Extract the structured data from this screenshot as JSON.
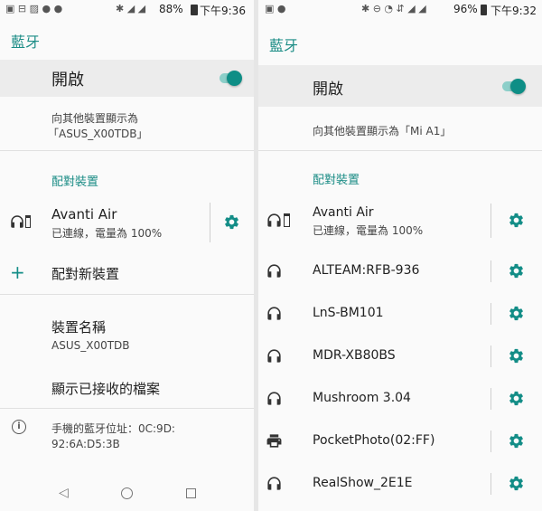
{
  "left": {
    "status": {
      "battery": "88%",
      "time": "下午9:36"
    },
    "title": "藍牙",
    "toggle_label": "開啟",
    "visibility_line1": "向其他裝置顯示為",
    "visibility_line2": "「ASUS_X00TDB」",
    "section_paired": "配對裝置",
    "device": {
      "name": "Avanti Air",
      "status": "已連線，電量為 100%"
    },
    "pair_new": "配對新裝置",
    "device_name_label": "裝置名稱",
    "device_name_value": "ASUS_X00TDB",
    "received_files": "顯示已接收的檔案",
    "address_line1": "手機的藍牙位址：0C:9D:",
    "address_line2": "92:6A:D5:3B"
  },
  "right": {
    "status": {
      "battery": "96%",
      "time": "下午9:32"
    },
    "title": "藍牙",
    "toggle_label": "開啟",
    "visibility": "向其他裝置顯示為「Mi A1」",
    "section_paired": "配對裝置",
    "devices": [
      {
        "name": "Avanti Air",
        "status": "已連線，電量為 100%",
        "icon": "headset-battery-icon"
      },
      {
        "name": "ALTEAM:RFB-936",
        "icon": "headphones-icon"
      },
      {
        "name": "LnS-BM101",
        "icon": "headphones-icon"
      },
      {
        "name": "MDR-XB80BS",
        "icon": "headphones-icon"
      },
      {
        "name": "Mushroom 3.04",
        "icon": "headphones-icon"
      },
      {
        "name": "PocketPhoto(02:FF)",
        "icon": "printer-icon"
      },
      {
        "name": "RealShow_2E1E",
        "icon": "headphones-icon"
      }
    ]
  },
  "colors": {
    "accent": "#138d87",
    "background": "#fafafa",
    "selected_row": "#ececec"
  }
}
